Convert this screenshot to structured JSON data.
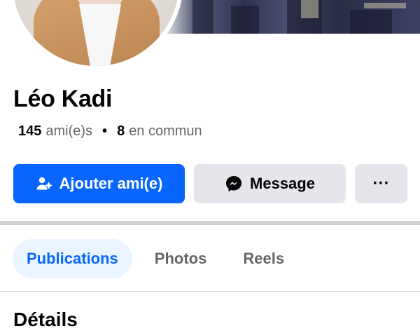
{
  "profile": {
    "name": "Léo Kadi",
    "friends_count": "145",
    "friends_label": "ami(e)s",
    "mutual_count": "8",
    "mutual_label": "en commun"
  },
  "actions": {
    "add_friend_label": "Ajouter ami(e)",
    "message_label": "Message",
    "more_label": "···"
  },
  "tabs": [
    {
      "label": "Publications",
      "active": true
    },
    {
      "label": "Photos",
      "active": false
    },
    {
      "label": "Reels",
      "active": false
    }
  ],
  "section": {
    "title": "Détails"
  },
  "colors": {
    "accent": "#0866ff",
    "button_secondary": "#e4e6eb",
    "tab_active_bg": "#ebf5ff",
    "text_secondary": "#65676b"
  },
  "icons": {
    "add_friend": "person-plus-icon",
    "message": "messenger-icon",
    "more": "more-dots-icon"
  }
}
